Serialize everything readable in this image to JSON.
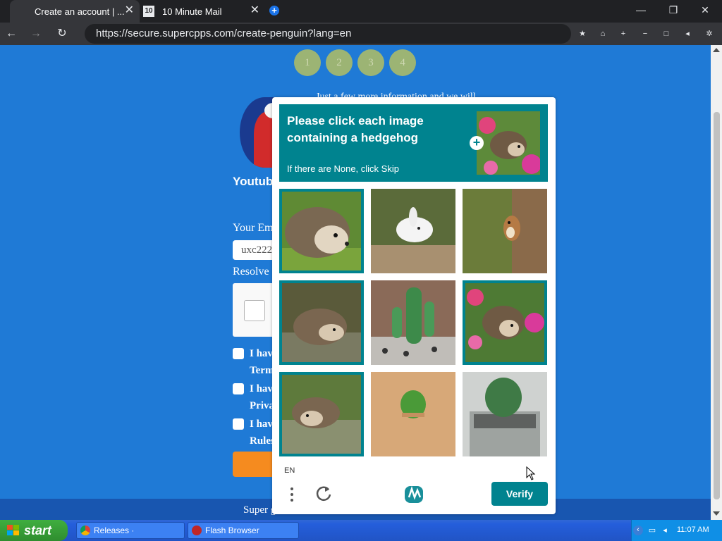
{
  "browser": {
    "tabs": [
      {
        "title": "Create an account | ...",
        "close": "✕"
      },
      {
        "title": "10 Minute Mail",
        "favicon_text": "10",
        "close": "✕"
      }
    ],
    "new_tab": "+",
    "url": "https://secure.supercpps.com/create-penguin?lang=en",
    "window_controls": {
      "minimize": "—",
      "restore": "❐",
      "close": "✕"
    },
    "nav": {
      "back": "←",
      "forward": "→",
      "reload": "↻"
    }
  },
  "page": {
    "steps": [
      "1",
      "2",
      "3",
      "4"
    ],
    "info_text": "Just a few more information and we will",
    "username": "Youtub",
    "email_label": "Your Em",
    "email_value": "uxc222",
    "resolve_label": "Resolve",
    "checkbox_lines": [
      {
        "line1": "I hav",
        "line2": "Term"
      },
      {
        "line1": "I hav",
        "line2": "Priva"
      },
      {
        "line1": "I hav",
        "line2": "Rules"
      }
    ],
    "footer_text": "Super                                                                   g"
  },
  "captcha": {
    "prompt_title": "Please click each image containing a hedgehog",
    "prompt_sub": "If there are None, click Skip",
    "tiles": [
      {
        "subject": "hedgehog",
        "selected": true
      },
      {
        "subject": "white rabbit",
        "selected": false
      },
      {
        "subject": "squirrel on tree",
        "selected": false
      },
      {
        "subject": "hedgehog in water",
        "selected": true
      },
      {
        "subject": "cactus in pot",
        "selected": false
      },
      {
        "subject": "hedgehog with flowers",
        "selected": true
      },
      {
        "subject": "hedgehog in water",
        "selected": true
      },
      {
        "subject": "cactus in sand",
        "selected": false
      },
      {
        "subject": "cactus in pot",
        "selected": false
      }
    ],
    "language": "EN",
    "verify_label": "Verify",
    "accent_color": "#00838f"
  },
  "taskbar": {
    "start_label": "start",
    "tasks": [
      {
        "label": "Releases · radubirsan/..."
      },
      {
        "label": "Flash Browser"
      }
    ],
    "time": "11:07 AM"
  }
}
